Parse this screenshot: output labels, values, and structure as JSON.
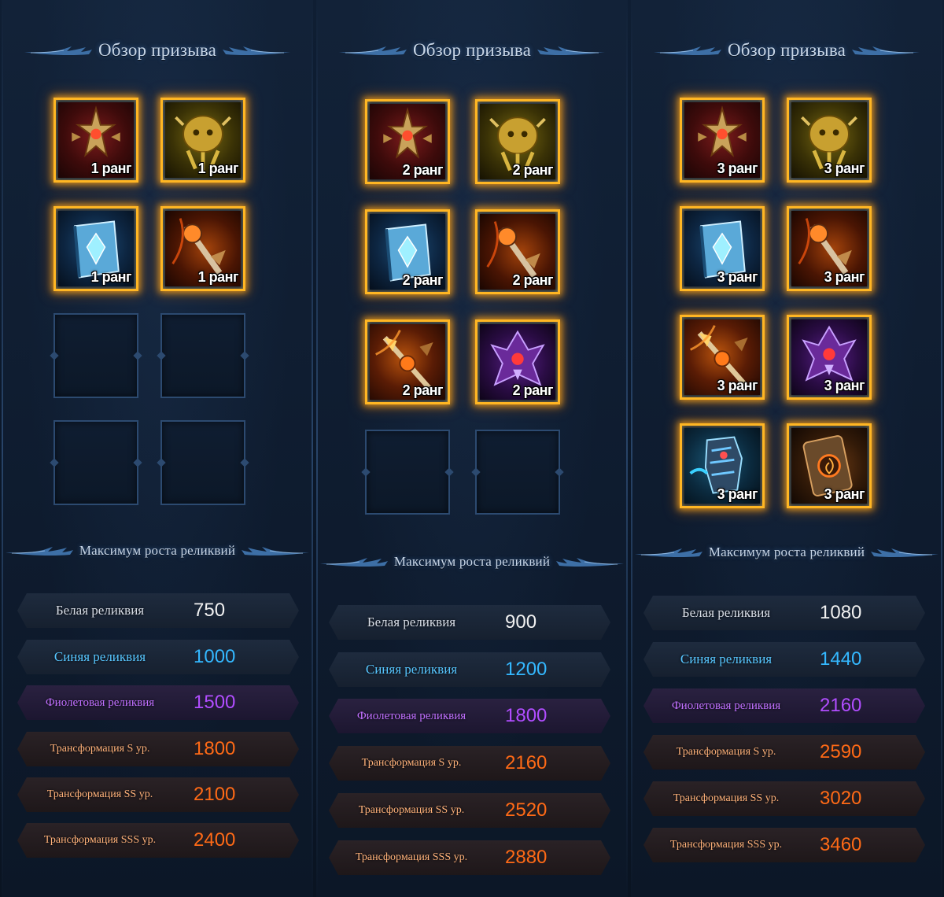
{
  "colors": {
    "white_relic": "#f1f1f1",
    "blue_relic": "#34b8ff",
    "purple_relic": "#b14dff",
    "transformation": "#ff6a16",
    "slot_border_active": "#ffb623"
  },
  "panels": [
    {
      "header": "Обзор призыва",
      "subheader": "Максимум роста реликвий",
      "slots": [
        {
          "icon": "red-cross-relic-icon",
          "rank": "1 ранг"
        },
        {
          "icon": "golden-beast-relic-icon",
          "rank": "1 ранг"
        },
        {
          "icon": "blue-crystal-tome-icon",
          "rank": "1 ранг"
        },
        {
          "icon": "fire-scepter-icon",
          "rank": "1 ранг"
        }
      ],
      "stats": [
        {
          "label": "Белая реликвия",
          "value": "750"
        },
        {
          "label": "Синяя реликвия",
          "value": "1000"
        },
        {
          "label": "Фиолетовая реликвия",
          "value": "1500"
        },
        {
          "label": "Трансформация S ур.",
          "value": "1800"
        },
        {
          "label": "Трансформация SS ур.",
          "value": "2100"
        },
        {
          "label": "Трансформация SSS ур.",
          "value": "2400"
        }
      ]
    },
    {
      "header": "Обзор призыва",
      "subheader": "Максимум роста реликвий",
      "slots": [
        {
          "icon": "red-cross-relic-icon",
          "rank": "2 ранг"
        },
        {
          "icon": "golden-beast-relic-icon",
          "rank": "2 ранг"
        },
        {
          "icon": "blue-crystal-tome-icon",
          "rank": "2 ранг"
        },
        {
          "icon": "fire-scepter-icon",
          "rank": "2 ранг"
        },
        {
          "icon": "flame-spear-icon",
          "rank": "2 ранг"
        },
        {
          "icon": "purple-demon-relic-icon",
          "rank": "2 ранг"
        }
      ],
      "stats": [
        {
          "label": "Белая реликвия",
          "value": "900"
        },
        {
          "label": "Синяя реликвия",
          "value": "1200"
        },
        {
          "label": "Фиолетовая реликвия",
          "value": "1800"
        },
        {
          "label": "Трансформация S ур.",
          "value": "2160"
        },
        {
          "label": "Трансформация SS ур.",
          "value": "2520"
        },
        {
          "label": "Трансформация SSS ур.",
          "value": "2880"
        }
      ]
    },
    {
      "header": "Обзор призыва",
      "subheader": "Максимум роста реликвий",
      "slots": [
        {
          "icon": "red-cross-relic-icon",
          "rank": "3 ранг"
        },
        {
          "icon": "golden-beast-relic-icon",
          "rank": "3 ранг"
        },
        {
          "icon": "blue-crystal-tome-icon",
          "rank": "3 ранг"
        },
        {
          "icon": "fire-scepter-icon",
          "rank": "3 ранг"
        },
        {
          "icon": "flame-spear-icon",
          "rank": "3 ранг"
        },
        {
          "icon": "purple-demon-relic-icon",
          "rank": "3 ранг"
        },
        {
          "icon": "cyan-armored-gauntlet-icon",
          "rank": "3 ранг"
        },
        {
          "icon": "bronze-vortex-shield-icon",
          "rank": "3 ранг"
        }
      ],
      "stats": [
        {
          "label": "Белая реликвия",
          "value": "1080"
        },
        {
          "label": "Синяя реликвия",
          "value": "1440"
        },
        {
          "label": "Фиолетовая реликвия",
          "value": "2160"
        },
        {
          "label": "Трансформация S ур.",
          "value": "2590"
        },
        {
          "label": "Трансформация SS ур.",
          "value": "3020"
        },
        {
          "label": "Трансформация SSS ур.",
          "value": "3460"
        }
      ]
    }
  ]
}
